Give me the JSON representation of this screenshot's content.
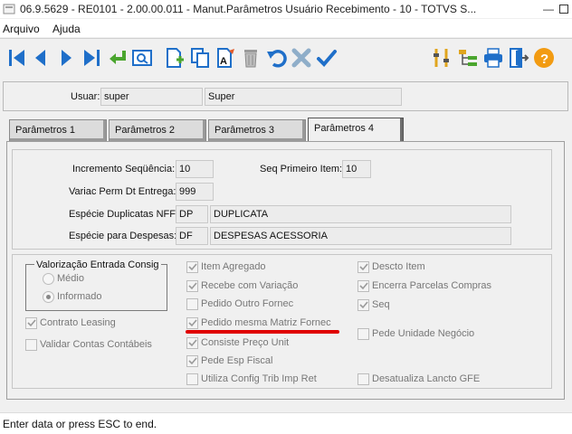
{
  "window": {
    "title": "06.9.5629 - RE0101 - 2.00.00.011 - Manut.Parâmetros Usuário Recebimento - 10 - TOTVS S...",
    "minimize": "—"
  },
  "menu": [
    "Arquivo",
    "Ajuda"
  ],
  "toolbar": {
    "icons": [
      "first-record-icon",
      "previous-record-icon",
      "next-record-icon",
      "last-record-icon",
      "goto-icon",
      "search-icon",
      "new-record-icon",
      "copy-record-icon",
      "edit-record-icon",
      "delete-record-icon",
      "undo-icon",
      "cancel-icon",
      "confirm-icon",
      "tools-icon",
      "hierarchy-icon",
      "print-icon",
      "exit-icon",
      "help-icon"
    ]
  },
  "user": {
    "label": "Usuar:",
    "code": "super",
    "name": "Super"
  },
  "tabs": [
    "Parâmetros 1",
    "Parâmetros 2",
    "Parâmetros 3",
    "Parâmetros 4"
  ],
  "active_tab": "Parâmetros 4",
  "fields": {
    "incremento_label": "Incremento Seqüência:",
    "incremento_value": "10",
    "seq_primeiro_label": "Seq Primeiro Item:",
    "seq_primeiro_value": "10",
    "variac_label": "Variac Perm Dt Entrega:",
    "variac_value": "999",
    "especie_dup_label": "Espécie Duplicatas NFF:",
    "especie_dup_code": "DP",
    "especie_dup_desc": "DUPLICATA",
    "especie_desp_label": "Espécie para Despesas:",
    "especie_desp_code": "DF",
    "especie_desp_desc": "DESPESAS ACESSORIA"
  },
  "valorizacao": {
    "legend": "Valorização Entrada Consig",
    "options": [
      "Médio",
      "Informado"
    ],
    "selected": "Informado"
  },
  "checkboxes": {
    "contrato_leasing": {
      "label": "Contrato Leasing",
      "checked": true
    },
    "validar_contas": {
      "label": "Validar Contas Contábeis",
      "checked": false
    },
    "item_agregado": {
      "label": "Item Agregado",
      "checked": true
    },
    "recebe_variacao": {
      "label": "Recebe com Variação",
      "checked": true
    },
    "pedido_outro": {
      "label": "Pedido Outro Fornec",
      "checked": false
    },
    "pedido_mesma": {
      "label": "Pedido mesma Matriz Fornec",
      "checked": true
    },
    "consiste_preco": {
      "label": "Consiste Preço Unit",
      "checked": true
    },
    "pede_esp_fiscal": {
      "label": "Pede Esp Fiscal",
      "checked": true
    },
    "utiliza_config": {
      "label": "Utiliza Config Trib Imp Ret",
      "checked": false
    },
    "descto_item": {
      "label": "Descto Item",
      "checked": true
    },
    "encerra_parcelas": {
      "label": "Encerra Parcelas Compras",
      "checked": true
    },
    "seq": {
      "label": "Seq",
      "checked": true
    },
    "pede_unidade": {
      "label": "Pede Unidade Negócio",
      "checked": false
    },
    "desatualiza": {
      "label": "Desatualiza Lancto GFE",
      "checked": false
    }
  },
  "annotation_color": "#e00000",
  "status": "Enter data or press ESC to end."
}
